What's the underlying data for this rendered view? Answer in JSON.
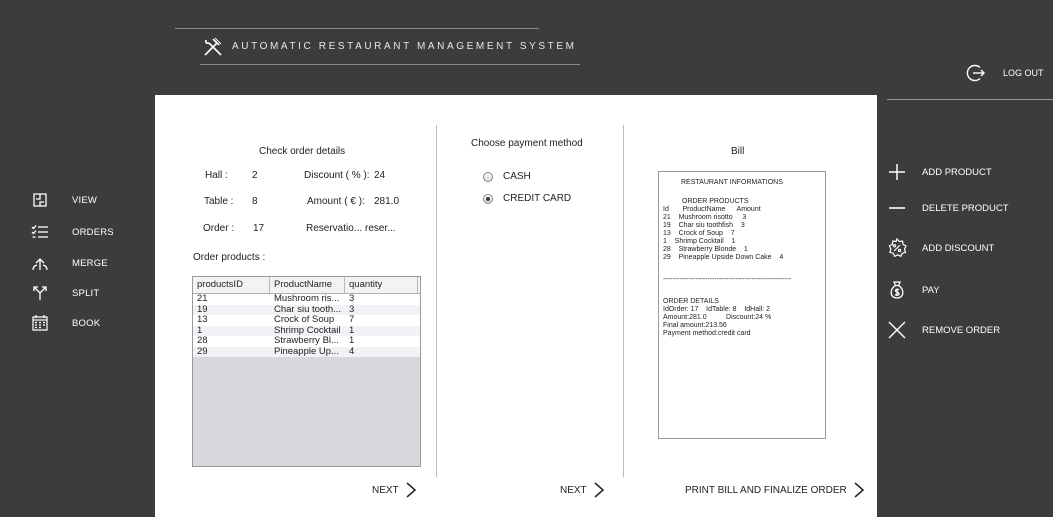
{
  "header": {
    "title": "AUTOMATIC RESTAURANT MANAGEMENT SYSTEM",
    "logout_label": "LOG OUT"
  },
  "nav": {
    "items": [
      {
        "label": "VIEW",
        "icon": "view-icon"
      },
      {
        "label": "ORDERS",
        "icon": "list-icon"
      },
      {
        "label": "MERGE",
        "icon": "merge-icon"
      },
      {
        "label": "SPLIT",
        "icon": "split-icon"
      },
      {
        "label": "BOOK",
        "icon": "calendar-icon"
      }
    ]
  },
  "actions": {
    "items": [
      {
        "label": "ADD PRODUCT",
        "icon": "plus-icon"
      },
      {
        "label": "DELETE PRODUCT",
        "icon": "minus-icon"
      },
      {
        "label": "ADD DISCOUNT",
        "icon": "discount-icon"
      },
      {
        "label": "PAY",
        "icon": "money-bag-icon"
      },
      {
        "label": "REMOVE ORDER",
        "icon": "close-icon"
      }
    ]
  },
  "details": {
    "title": "Check order details",
    "hall_label": "Hall :",
    "hall_value": "2",
    "discount_label": "Discount ( % ):",
    "discount_value": "24",
    "table_label": "Table :",
    "table_value": "8",
    "amount_label": "Amount ( € ):",
    "amount_value": "281.0",
    "order_label": "Order :",
    "order_value": "17",
    "reservation_label": "Reservatio...",
    "reservation_value": "reser...",
    "products_label": "Order products :",
    "columns": [
      "productsID",
      "ProductName",
      "quantity"
    ],
    "rows": [
      [
        "21",
        "Mushroom ris...",
        "3"
      ],
      [
        "19",
        "Char siu tooth...",
        "3"
      ],
      [
        "13",
        "Crock of Soup",
        "7"
      ],
      [
        "1",
        "Shrimp Cocktail",
        "1"
      ],
      [
        "28",
        "Strawberry Bl...",
        "1"
      ],
      [
        "29",
        "Pineapple Up...",
        "4"
      ]
    ],
    "next_label": "NEXT"
  },
  "payment": {
    "title": "Choose payment method",
    "options": [
      {
        "label": "CASH",
        "selected": false
      },
      {
        "label": "CREDIT CARD",
        "selected": true
      }
    ],
    "next_label": "NEXT"
  },
  "bill": {
    "title": "Bill",
    "heading": "RESTAURANT INFORMATIONS",
    "products_heading": "ORDER PRODUCTS",
    "columns_line": "Id       ProductName      Amount",
    "lines": [
      "21    Mushroom risotto     3",
      "19    Char siu toothfish    3",
      "13    Crock of Soup    7",
      "1    Shrimp Cocktail    1",
      "28    Strawberry Blonde    1",
      "29    Pineapple Upside Down Cake    4"
    ],
    "separator": "-------------------------------------------------------",
    "details_heading": "ORDER DETAILS",
    "details_line1": "IdOrder: 17    IdTable: 8    IdHall: 2",
    "details_line2": "Amount:281.0          Discount:24 %",
    "details_line3": "Final amount:213.56",
    "details_line4": "Payment method:credit card",
    "finalize_label": "PRINT BILL AND FINALIZE ORDER"
  }
}
